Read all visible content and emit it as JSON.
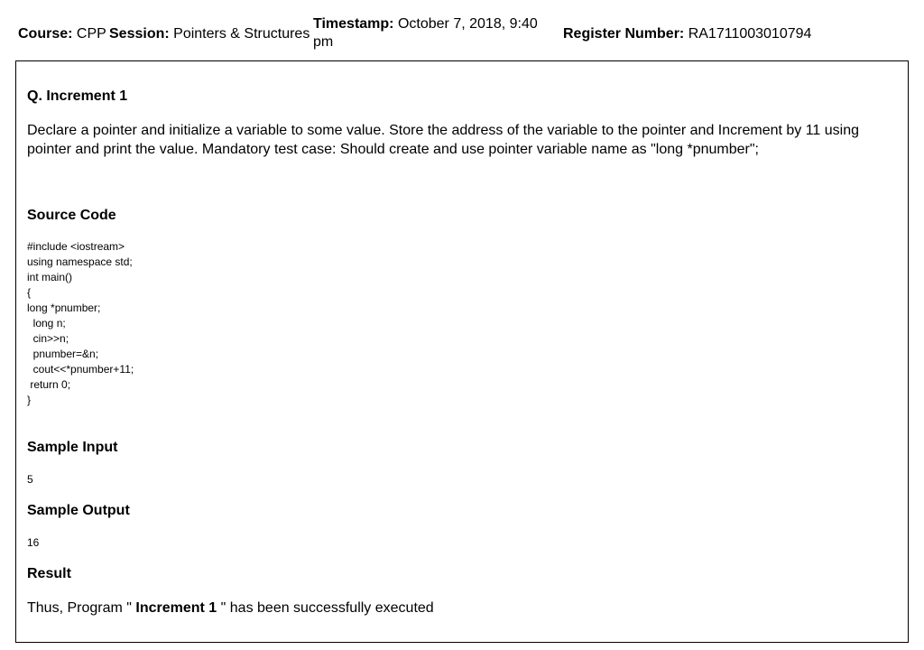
{
  "header": {
    "course_label": "Course:",
    "course_value": "CPP",
    "session_label": "Session:",
    "session_value": "Pointers & Structures",
    "timestamp_label": "Timestamp:",
    "timestamp_value": "October 7, 2018, 9:40 pm",
    "register_label": "Register Number:",
    "register_value": "RA1711003010794"
  },
  "question": {
    "title": "Q. Increment 1",
    "text": "Declare a pointer and initialize a variable to some value. Store the address of the variable to the pointer and Increment by 11 using pointer and print the value. Mandatory test case: Should create and use pointer variable name as \"long *pnumber\";"
  },
  "source": {
    "heading": "Source Code",
    "code": "#include <iostream>\nusing namespace std;\nint main()\n{\nlong *pnumber;\n  long n;\n  cin>>n;\n  pnumber=&n;\n  cout<<*pnumber+11;\n return 0;\n}"
  },
  "sample_input": {
    "heading": "Sample Input",
    "value": "5"
  },
  "sample_output": {
    "heading": "Sample Output",
    "value": "16"
  },
  "result": {
    "heading": "Result",
    "prefix": "Thus, Program \" ",
    "program_name": "Increment 1",
    "suffix": " \" has been successfully executed"
  }
}
